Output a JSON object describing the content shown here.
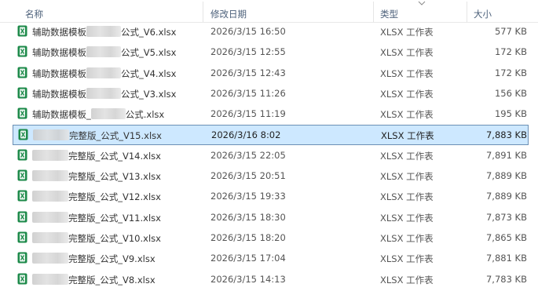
{
  "columns": {
    "name": "名称",
    "date_modified": "修改日期",
    "type": "类型",
    "size": "大小"
  },
  "icons": {
    "file": "excel-file-icon",
    "sort": "chevron-down-icon"
  },
  "colors": {
    "excel_green": "#1d8a4a",
    "selection_bg": "#cde8ff",
    "selection_border": "#6b8fb4"
  },
  "files": [
    {
      "name_prefix": "辅助数据模板",
      "name_suffix": "公式_V6.xlsx",
      "date": "2026/3/15 16:50",
      "type": "XLSX 工作表",
      "size": "577 KB"
    },
    {
      "name_prefix": "辅助数据模板",
      "name_suffix": "公式_V5.xlsx",
      "date": "2026/3/15 12:55",
      "type": "XLSX 工作表",
      "size": "172 KB"
    },
    {
      "name_prefix": "辅助数据模板",
      "name_suffix": "公式_V4.xlsx",
      "date": "2026/3/15 12:43",
      "type": "XLSX 工作表",
      "size": "172 KB"
    },
    {
      "name_prefix": "辅助数据模板",
      "name_suffix": "公式_V3.xlsx",
      "date": "2026/3/15 11:26",
      "type": "XLSX 工作表",
      "size": "156 KB"
    },
    {
      "name_prefix": "辅助数据模板_",
      "name_suffix": "公式.xlsx",
      "date": "2026/3/15 11:19",
      "type": "XLSX 工作表",
      "size": "195 KB"
    },
    {
      "name_prefix": "",
      "name_suffix": "完整版_公式_V15.xlsx",
      "date": "2026/3/16 8:02",
      "type": "XLSX 工作表",
      "size": "7,883 KB",
      "selected": true
    },
    {
      "name_prefix": "",
      "name_suffix": "完整版_公式_V14.xlsx",
      "date": "2026/3/15 22:05",
      "type": "XLSX 工作表",
      "size": "7,891 KB"
    },
    {
      "name_prefix": "",
      "name_suffix": "完整版_公式_V13.xlsx",
      "date": "2026/3/15 20:51",
      "type": "XLSX 工作表",
      "size": "7,889 KB"
    },
    {
      "name_prefix": "",
      "name_suffix": "完整版_公式_V12.xlsx",
      "date": "2026/3/15 19:33",
      "type": "XLSX 工作表",
      "size": "7,889 KB"
    },
    {
      "name_prefix": "",
      "name_suffix": "完整版_公式_V11.xlsx",
      "date": "2026/3/15 18:30",
      "type": "XLSX 工作表",
      "size": "7,873 KB"
    },
    {
      "name_prefix": "",
      "name_suffix": "完整版_公式_V10.xlsx",
      "date": "2026/3/15 18:20",
      "type": "XLSX 工作表",
      "size": "7,865 KB"
    },
    {
      "name_prefix": "",
      "name_suffix": "完整版_公式_V9.xlsx",
      "date": "2026/3/15 17:04",
      "type": "XLSX 工作表",
      "size": "7,881 KB"
    },
    {
      "name_prefix": "",
      "name_suffix": "完整版_公式_V8.xlsx",
      "date": "2026/3/15 14:13",
      "type": "XLSX 工作表",
      "size": "7,783 KB"
    }
  ]
}
